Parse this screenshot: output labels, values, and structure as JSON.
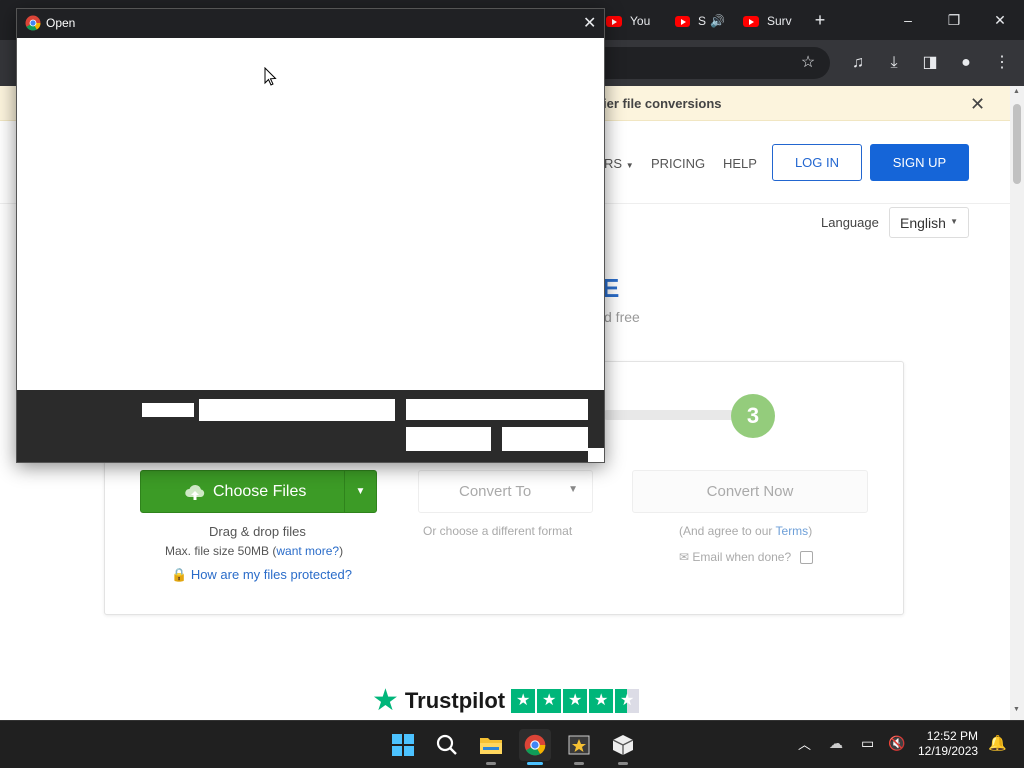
{
  "browser": {
    "tabs": [
      {
        "label": "You",
        "icon": "youtube-icon"
      },
      {
        "label": "S",
        "icon": "youtube-icon"
      },
      {
        "label": "Surv",
        "icon": "youtube-icon"
      }
    ],
    "new_tab_label": "+",
    "window_controls": {
      "minimize": "–",
      "restore": "❐",
      "close": "✕"
    }
  },
  "page": {
    "banner": {
      "text": "ier file conversions",
      "close": "✕"
    },
    "nav": {
      "tools_fragment": "RS",
      "pricing": "PRICING",
      "help": "HELP",
      "login": "LOG IN",
      "signup": "SIGN UP"
    },
    "language": {
      "label": "Language",
      "value": "English"
    },
    "hero": {
      "title_fragment": "E",
      "subtitle_fragment": "d free"
    },
    "converter": {
      "step_number": "3",
      "choose_files": "Choose Files",
      "convert_to": "Convert To",
      "convert_now": "Convert Now",
      "drag_drop": "Drag & drop files",
      "max_size_prefix": "Max. file size 50MB (",
      "want_more": "want more?",
      "max_size_suffix": ")",
      "protected_link": "How are my files protected?",
      "choose_format": "Or choose a different format",
      "agree_prefix": "(And agree to our ",
      "terms": "Terms",
      "agree_suffix": ")",
      "email_label": "Email when done?"
    },
    "trustpilot": {
      "word": "Trustpilot",
      "stars": 4.5
    }
  },
  "dialog": {
    "title": "Open",
    "close": "✕"
  },
  "taskbar": {
    "apps": [
      "start-icon",
      "search-icon",
      "file-explorer-icon",
      "chrome-icon",
      "video-editor-icon",
      "package-icon"
    ],
    "time": "12:52 PM",
    "date": "12/19/2023"
  },
  "colors": {
    "accent_blue": "#1565d8",
    "green": "#3c9b26",
    "banner": "#fcf4dd",
    "trustpilot": "#00b67a"
  }
}
